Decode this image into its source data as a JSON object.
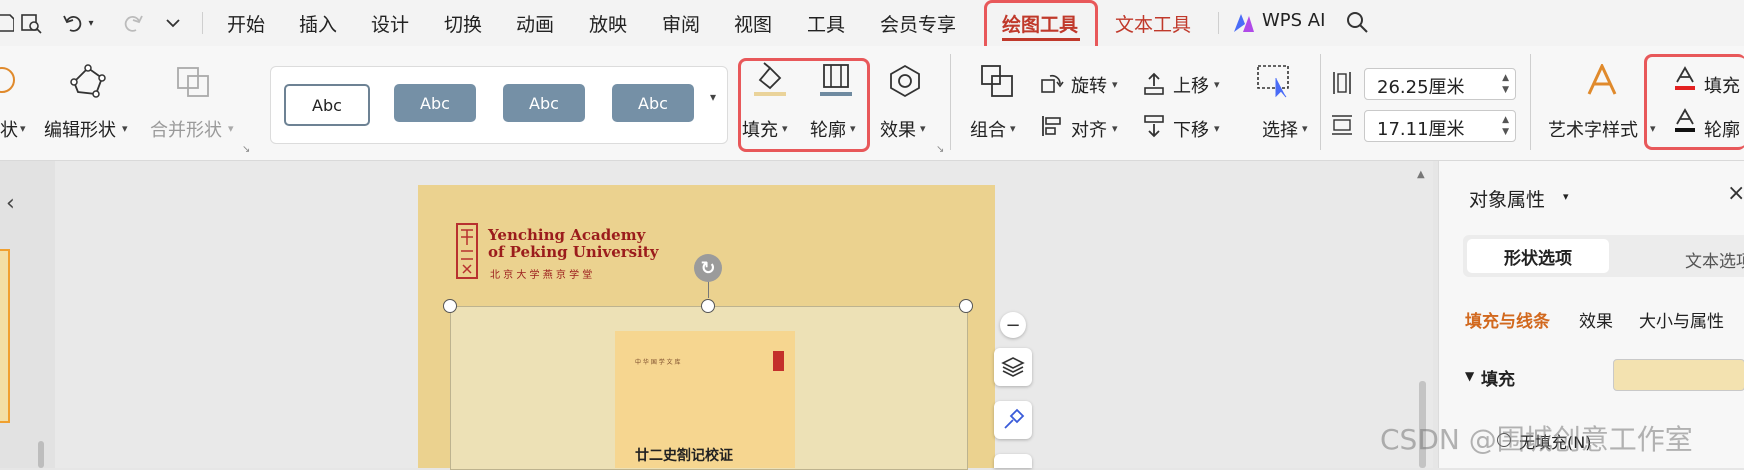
{
  "menu": {
    "items": [
      "开始",
      "插入",
      "设计",
      "切换",
      "动画",
      "放映",
      "审阅",
      "视图",
      "工具",
      "会员专享"
    ],
    "drawing_tools": "绘图工具",
    "text_tools": "文本工具",
    "wps_ai": "WPS AI"
  },
  "ribbon": {
    "shape_label_partial": "状",
    "edit_shape": "编辑形状",
    "merge_shape": "合并形状",
    "styles": [
      "Abc",
      "Abc",
      "Abc",
      "Abc"
    ],
    "fill": "填充",
    "outline": "轮廓",
    "effect": "效果",
    "group": "组合",
    "rotate": "旋转",
    "align": "对齐",
    "move_up": "上移",
    "move_down": "下移",
    "select": "选择",
    "width": "26.25厘米",
    "height": "17.11厘米",
    "art_text": "艺术字样式",
    "text_fill": "填充",
    "text_outline": "轮廓"
  },
  "slide": {
    "logo_line1": "Yenching Academy",
    "logo_line2": "of Peking University",
    "logo_cn": "北 京 大 学 燕 京 学 堂",
    "book_series": "中 华 国 学 文 库",
    "book_title": "廿二史劄记校证"
  },
  "panel": {
    "title": "对象属性",
    "tab_shape": "形状选项",
    "tab_text": "文本选项",
    "sub_fill_line": "填充与线条",
    "sub_effect": "效果",
    "sub_size": "大小与属性",
    "fill_heading": "填充",
    "fill_option": "无填充(N)",
    "fill_color": "#f3e2b0"
  },
  "watermark": "CSDN @围城创意工作室",
  "colors": {
    "accent_red": "#e8585a",
    "active_tab": "#c0392b",
    "style_fill": "#7590a6",
    "panel_accent": "#d2691e"
  }
}
